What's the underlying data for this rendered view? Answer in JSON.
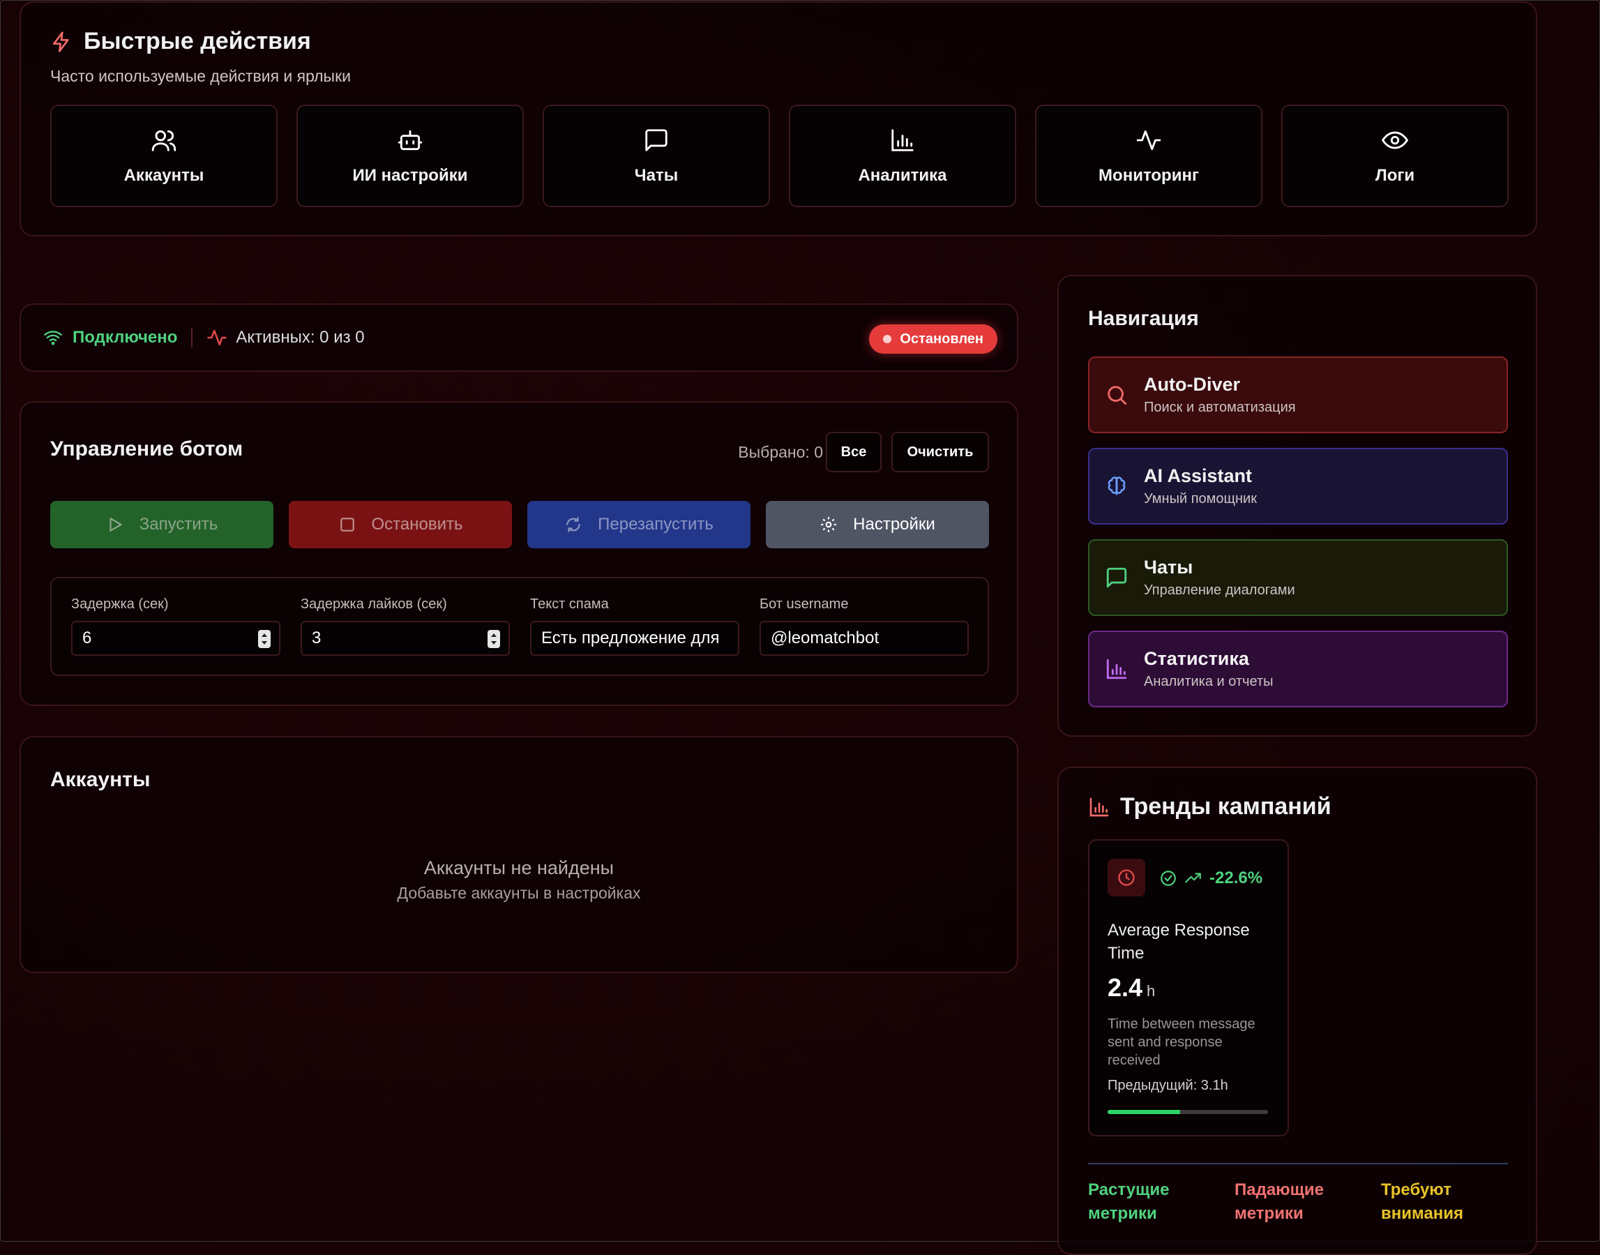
{
  "quick_actions": {
    "title": "Быстрые действия",
    "subtitle": "Часто используемые действия и ярлыки",
    "items": [
      {
        "label": "Аккаунты",
        "icon": "users-icon"
      },
      {
        "label": "ИИ настройки",
        "icon": "bot-icon"
      },
      {
        "label": "Чаты",
        "icon": "message-icon"
      },
      {
        "label": "Аналитика",
        "icon": "bar-chart-icon"
      },
      {
        "label": "Мониторинг",
        "icon": "activity-icon"
      },
      {
        "label": "Логи",
        "icon": "eye-icon"
      }
    ]
  },
  "status": {
    "connection": "Подключено",
    "active": "Активных: 0 из 0",
    "badge": "Остановлен"
  },
  "bot_control": {
    "title": "Управление ботом",
    "selected": "Выбрано: 0",
    "all_label": "Все",
    "clear_label": "Очистить",
    "start_label": "Запустить",
    "stop_label": "Остановить",
    "restart_label": "Перезапустить",
    "settings_label": "Настройки",
    "fields": {
      "delay_label": "Задержка (сек)",
      "delay_value": "6",
      "like_delay_label": "Задержка лайков (сек)",
      "like_delay_value": "3",
      "spam_label": "Текст спама",
      "spam_value": "Есть предложение для",
      "bot_label": "Бот username",
      "bot_value": "@leomatchbot"
    }
  },
  "accounts": {
    "title": "Аккаунты",
    "empty_title": "Аккаунты не найдены",
    "empty_hint": "Добавьте аккаунты в настройках"
  },
  "navigation": {
    "title": "Навигация",
    "items": [
      {
        "title": "Auto-Diver",
        "subtitle": "Поиск и автоматизация",
        "icon": "search-icon"
      },
      {
        "title": "AI Assistant",
        "subtitle": "Умный помощник",
        "icon": "brain-icon"
      },
      {
        "title": "Чаты",
        "subtitle": "Управление диалогами",
        "icon": "message-icon"
      },
      {
        "title": "Статистика",
        "subtitle": "Аналитика и отчеты",
        "icon": "bar-chart-icon"
      }
    ]
  },
  "trends": {
    "title": "Тренды кампаний",
    "metric": {
      "change": "-22.6%",
      "name": "Average Response Time",
      "value": "2.4",
      "unit": "h",
      "description": "Time between message sent and response received",
      "previous": "Предыдущий: 3.1h",
      "progress": 0.45
    },
    "legend": {
      "growing": "Растущие метрики",
      "falling": "Падающие метрики",
      "attention": "Требуют внимания"
    }
  },
  "colors": {
    "accent_red": "#e53b3b",
    "green": "#4fd27f",
    "yellow": "#e8c22a",
    "pink": "#f07272"
  }
}
